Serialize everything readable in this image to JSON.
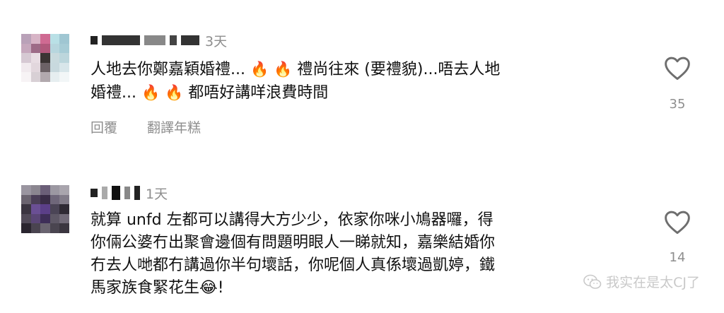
{
  "comments": [
    {
      "time": "3天",
      "line1_pre": "人地去你鄭嘉穎婚禮...",
      "line1_post": "禮尚往來 (要禮貌)...唔去人地",
      "line2_pre": "婚禮...",
      "line2_post": "都唔好講咩浪費時間",
      "emoji": "🔥",
      "reply_label": "回覆",
      "translate_label": "翻譯年糕",
      "likes": "35"
    },
    {
      "time": "1天",
      "line1": "就算 unfd 左都可以講得大方少少，依家你咪小鳩器囉，得",
      "line2": "你倆公婆冇出聚會邊個有問題明眼人一睇就知，嘉樂結婚你",
      "line3": "冇去人哋都冇講過你半句壞話，你呢個人真係壞過凱婷，鐵",
      "line4_pre": "馬家族食緊花生",
      "line4_emoji": "😂",
      "line4_post": "!",
      "likes": "14"
    }
  ],
  "watermark": "我实在是太CJ了",
  "icons": {
    "like": "heart-outline-icon",
    "watermark": "wechat-icon"
  },
  "colors": {
    "text": "#111111",
    "muted": "#8e8e8e"
  }
}
